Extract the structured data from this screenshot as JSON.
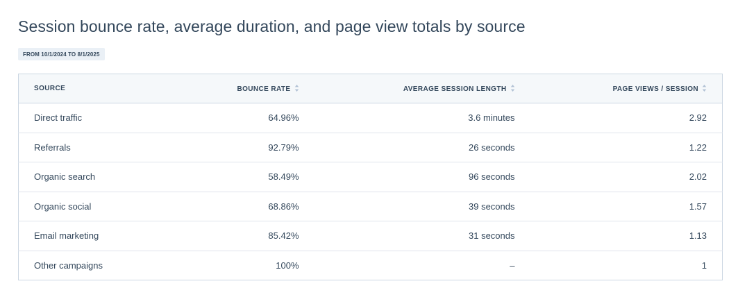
{
  "report": {
    "title": "Session bounce rate, average duration, and page view totals by source",
    "date_range": "FROM 10/1/2024 TO 8/1/2025"
  },
  "table": {
    "columns": [
      "SOURCE",
      "BOUNCE RATE",
      "AVERAGE SESSION LENGTH",
      "PAGE VIEWS / SESSION"
    ],
    "rows": [
      {
        "source": "Direct traffic",
        "bounce_rate": "64.96%",
        "avg_session_length": "3.6 minutes",
        "page_views_per_session": "2.92"
      },
      {
        "source": "Referrals",
        "bounce_rate": "92.79%",
        "avg_session_length": "26 seconds",
        "page_views_per_session": "1.22"
      },
      {
        "source": "Organic search",
        "bounce_rate": "58.49%",
        "avg_session_length": "96 seconds",
        "page_views_per_session": "2.02"
      },
      {
        "source": "Organic social",
        "bounce_rate": "68.86%",
        "avg_session_length": "39 seconds",
        "page_views_per_session": "1.57"
      },
      {
        "source": "Email marketing",
        "bounce_rate": "85.42%",
        "avg_session_length": "31 seconds",
        "page_views_per_session": "1.13"
      },
      {
        "source": "Other campaigns",
        "bounce_rate": "100%",
        "avg_session_length": "–",
        "page_views_per_session": "1"
      }
    ]
  },
  "colors": {
    "text": "#33475b",
    "header_bg": "#f5f8fa",
    "badge_bg": "#eaf0f6",
    "border": "#cbd6e2"
  },
  "icons": {
    "sort": "sort-icon"
  }
}
